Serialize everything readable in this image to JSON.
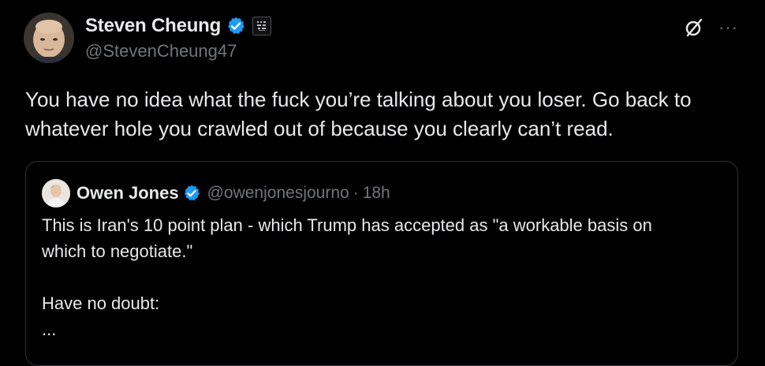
{
  "post": {
    "author_name": "Steven Cheung",
    "author_handle": "@StevenCheung47",
    "verified_icon": "verified-badge-icon",
    "affiliation_icon": "affiliation-badge-icon",
    "grok_icon": "grok-icon",
    "more_label": "···",
    "text": "You have no idea what the fuck you’re talking about you loser. Go back to whatever hole you crawled out of because you clearly can’t read."
  },
  "quoted": {
    "author_name": "Owen Jones",
    "author_handle": "@owenjonesjourno",
    "separator": "·",
    "time": "18h",
    "lines": [
      "This is Iran's 10 point plan - which Trump has accepted as \"a workable basis on",
      "which to negotiate.\"",
      "",
      "Have no doubt:",
      "..."
    ]
  },
  "colors": {
    "background": "#000000",
    "text": "#e7e9ea",
    "secondary": "#71767b",
    "verified_blue": "#1d9bf0",
    "border": "#2f3336"
  }
}
